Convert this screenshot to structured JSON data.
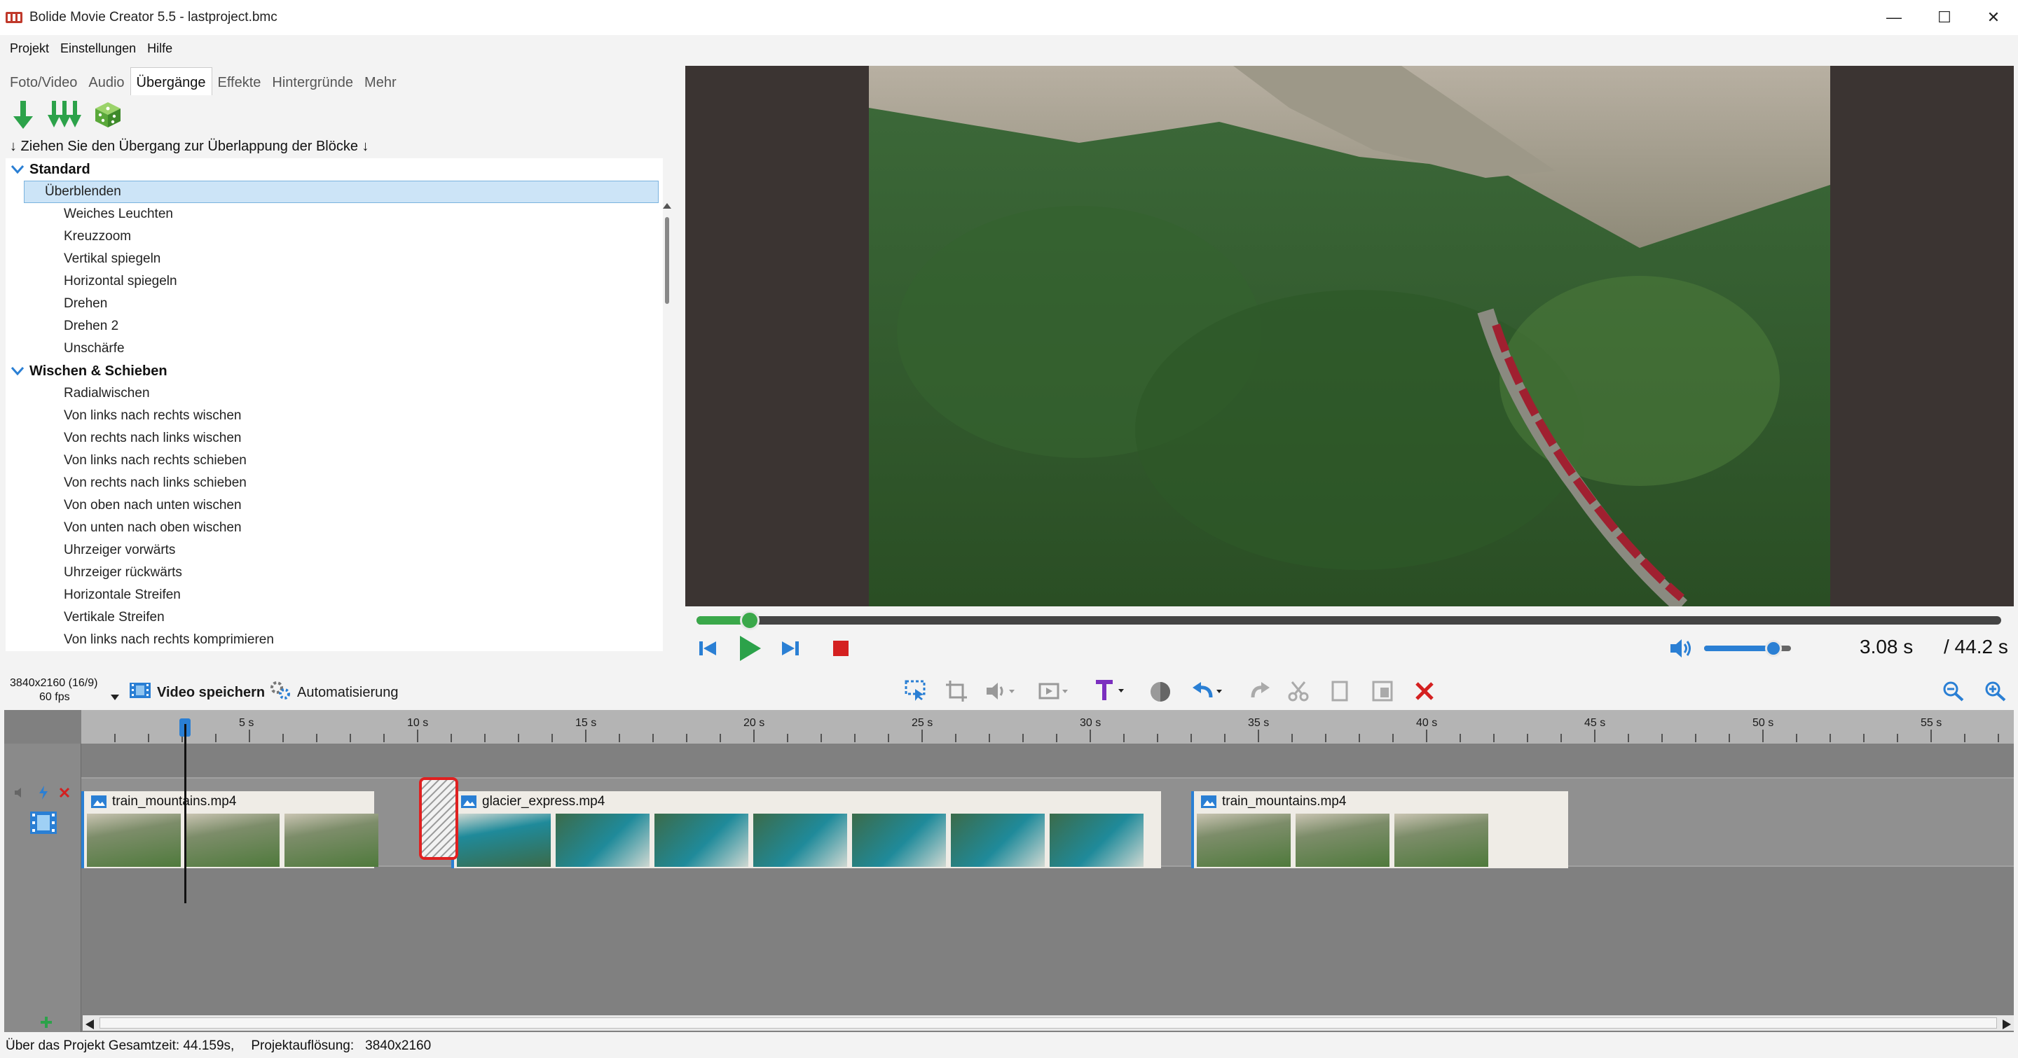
{
  "window": {
    "title": "Bolide Movie Creator 5.5 - lastproject.bmc",
    "minimize": "—",
    "maximize": "☐",
    "close": "✕"
  },
  "menu": [
    "Projekt",
    "Einstellungen",
    "Hilfe"
  ],
  "tabs": [
    "Foto/Video",
    "Audio",
    "Übergänge",
    "Effekte",
    "Hintergründe",
    "Mehr"
  ],
  "active_tab": "Übergänge",
  "hint": "↓ Ziehen Sie den Übergang zur Überlappung der Blöcke ↓",
  "groups": [
    {
      "name": "Standard",
      "items": [
        "Überblenden",
        "Weiches Leuchten",
        "Kreuzzoom",
        "Vertikal spiegeln",
        "Horizontal spiegeln",
        "Drehen",
        "Drehen 2",
        "Unschärfe"
      ]
    },
    {
      "name": "Wischen & Schieben",
      "items": [
        "Radialwischen",
        "Von links nach rechts wischen",
        "Von rechts nach links wischen",
        "Von links nach rechts schieben",
        "Von rechts nach links schieben",
        "Von oben nach unten wischen",
        "Von unten nach oben wischen",
        "Uhrzeiger vorwärts",
        "Uhrzeiger rückwärts",
        "Horizontale Streifen",
        "Vertikale Streifen",
        "Von links nach rechts komprimieren"
      ]
    }
  ],
  "selected_item": "Überblenden",
  "player": {
    "current_time": "3.08 s",
    "total_time": "/ 44.2 s",
    "progress": 0.041,
    "volume": 0.8
  },
  "toolbar": {
    "resolution": "3840x2160 (16/9)",
    "fps": "60 fps",
    "save_video": "Video speichern",
    "automation": "Automatisierung"
  },
  "ruler_labels": [
    "5 s",
    "10 s",
    "15 s",
    "20 s",
    "25 s",
    "30 s",
    "35 s",
    "40 s",
    "45 s",
    "50 s",
    "55 s"
  ],
  "clips": [
    {
      "name": "train_mountains.mp4",
      "start_s": 0.0,
      "end_s": 8.7,
      "thumbs": 3
    },
    {
      "name": "glacier_express.mp4",
      "start_s": 11.0,
      "end_s": 32.1,
      "thumbs": 7
    },
    {
      "name": "train_mountains.mp4",
      "start_s": 33.0,
      "end_s": 44.2,
      "thumbs": 3
    }
  ],
  "playhead_s": 3.08,
  "status": {
    "project_info": "Über das Projekt Gesamtzeit: 44.159s,",
    "resolution_label": "Projektauflösung:",
    "resolution_value": "3840x2160"
  },
  "colors": {
    "accent_blue": "#2a7fd4",
    "progress_green": "#3aa84a",
    "delete_red": "#d42020",
    "text_purple": "#7b2fbf"
  }
}
